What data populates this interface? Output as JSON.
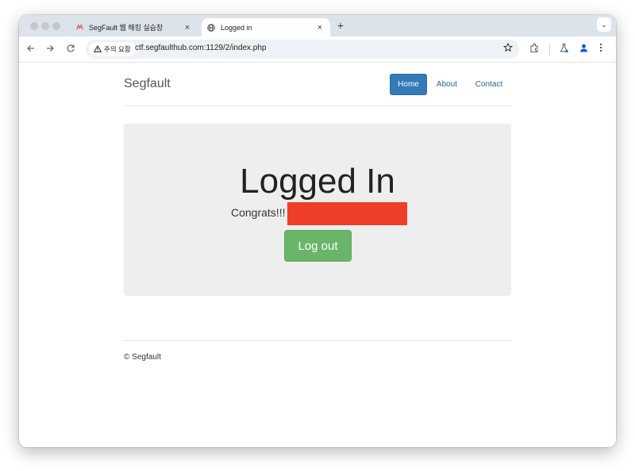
{
  "browser": {
    "tabs": [
      {
        "title": "SegFault 웹 해킹 실습장",
        "close": "×",
        "active": false
      },
      {
        "title": "Logged in",
        "close": "×",
        "active": true
      }
    ],
    "new_tab": "+",
    "tab_menu": "⌄",
    "security_chip": "주의 요함",
    "url": "ctf.segfaulthub.com:1129/2/index.php"
  },
  "site": {
    "brand": "Segfault",
    "nav": [
      {
        "label": "Home",
        "active": true
      },
      {
        "label": "About",
        "active": false
      },
      {
        "label": "Contact",
        "active": false
      }
    ]
  },
  "main": {
    "heading": "Logged In",
    "congrats": "Congrats!!!",
    "logout_label": "Log out"
  },
  "footer": {
    "text": "© Segfault"
  },
  "colors": {
    "nav_active": "#337ab7",
    "logout_button": "#6bb56b",
    "redaction": "#ee3e2a",
    "jumbotron_bg": "#eeeeee"
  }
}
